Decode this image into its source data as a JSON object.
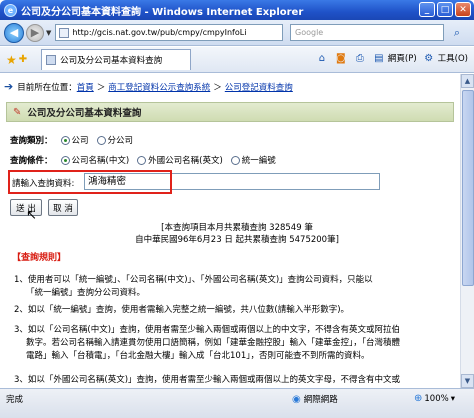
{
  "window": {
    "title": "公司及分公司基本資料查詢 - Windows Internet Explorer",
    "minimize": "_",
    "maximize": "□",
    "close": "✕"
  },
  "address_bar": {
    "url": "http://gcis.nat.gov.tw/pub/cmpy/cmpyInfoLi",
    "search_placeholder": "Google"
  },
  "tab": {
    "title": "公司及分公司基本資料查詢"
  },
  "command_bar": {
    "page_label": "網頁(P)",
    "tools_label": "工具(O)"
  },
  "breadcrumb": {
    "prefix": "目前所在位置：",
    "items": [
      "首頁",
      "商工登記資料公示查詢系統",
      "公司登記資料查詢"
    ],
    "separator": "＞"
  },
  "section": {
    "title": "公司及分公司基本資料查詢"
  },
  "query_type": {
    "label": "查詢類別：",
    "options": [
      "公司",
      "分公司"
    ],
    "selected": 0
  },
  "query_condition": {
    "label": "查詢條件：",
    "options": [
      "公司名稱(中文)",
      "外國公司名稱(英文)",
      "統一編號"
    ],
    "selected": 0
  },
  "query_input": {
    "label": "請輸入查詢資料:",
    "value": "鴻海精密"
  },
  "buttons": {
    "submit": "送 出",
    "cancel": "取 消"
  },
  "stats": {
    "line1": "[本查詢項目本月共累積查詢 328549 筆",
    "line2": "自中華民國96年6月23 日 起共累積查詢 5475200筆]"
  },
  "rules": {
    "title": "【查詢規則】",
    "rule1_line1": "1、使用者可以「統一編號」、「公司名稱(中文)」、「外國公司名稱(英文)」查詢公司資料，只能以",
    "rule1_line2": "「統一編號」查詢分公司資料。",
    "rule2": "2、如以「統一編號」查詢，使用者需輸入完整之統一編號，共八位數(請輸入半形數字)。",
    "rule3_line1": "3、如以「公司名稱(中文)」查詢，使用者需至少輸入兩個或兩個以上的中文字，不得含有英文或阿拉伯",
    "rule3_line2": "數字。若公司名稱輸入請連貫勿使用口語簡稱，例如「建華金融控股」輸入「建華金控」，「台灣積體",
    "rule3_line3": "電路」輸入「台積電」，「台北金融大樓」輸入成「台北101」，否則可能查不到所需的資料。",
    "rule4_line1": "3、如以「外國公司名稱(英文)」查詢，使用者需至少輸入兩個或兩個以上的英文字母，不得含有中文或"
  },
  "status_bar": {
    "done": "完成",
    "zone": "網際網路",
    "zoom": "100%"
  },
  "colors": {
    "highlight_border": "#e0221a",
    "rules_title": "#d81b10",
    "link_blue": "#1a3fb8"
  }
}
